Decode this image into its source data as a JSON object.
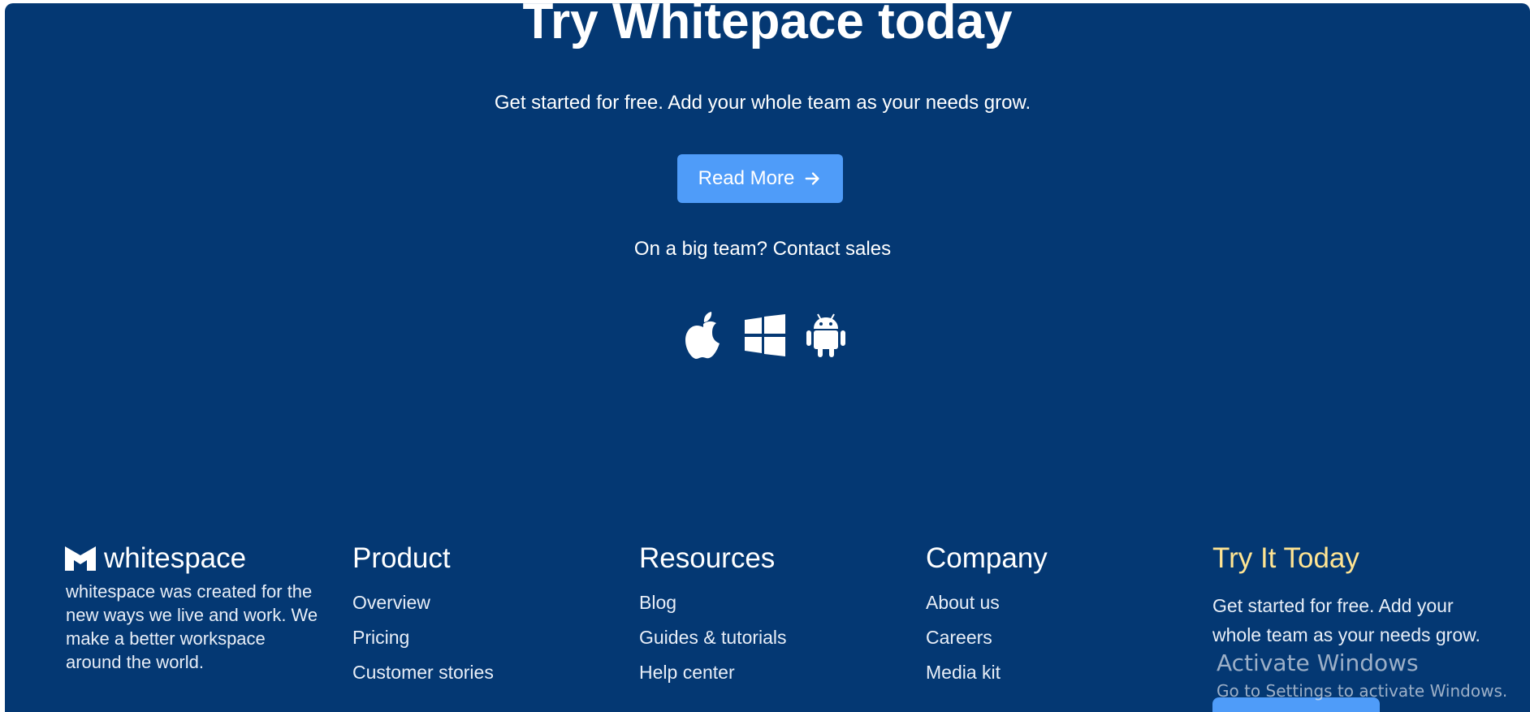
{
  "hero": {
    "title": "Try Whitepace today",
    "subtitle": "Get started for free. Add your whole team as your needs grow.",
    "read_more_label": "Read More",
    "contact_text": "On a big team? Contact sales"
  },
  "platforms": {
    "icons": [
      "apple-icon",
      "windows-icon",
      "android-icon"
    ]
  },
  "footer": {
    "brand_name": "whitespace",
    "about": "whitespace was created for the new ways we live and work. We make a better workspace around the world.",
    "columns": {
      "product": {
        "title": "Product",
        "links": [
          "Overview",
          "Pricing",
          "Customer stories"
        ]
      },
      "resources": {
        "title": "Resources",
        "links": [
          "Blog",
          "Guides & tutorials",
          "Help center"
        ]
      },
      "company": {
        "title": "Company",
        "links": [
          "About us",
          "Careers",
          "Media kit"
        ]
      },
      "try_it": {
        "title": "Try It Today",
        "text": "Get started for free. Add your whole team as your needs grow."
      }
    }
  },
  "watermark": {
    "title": "Activate Windows",
    "subtitle": "Go to Settings to activate Windows."
  },
  "colors": {
    "background": "#043873",
    "accent_button": "#4f9cf9",
    "highlight_heading": "#ffe492",
    "text": "#ffffff"
  }
}
